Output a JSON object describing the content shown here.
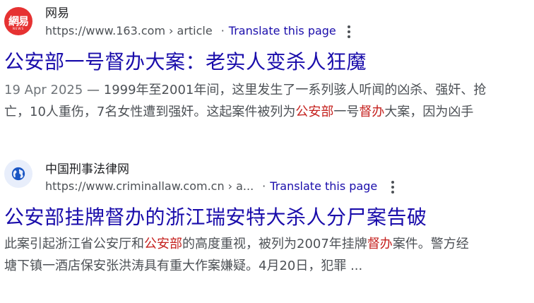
{
  "results": [
    {
      "site_name": "网易",
      "favicon_text": "網易",
      "favicon_sub": "NEWS",
      "url": "https://www.163.com",
      "breadcrumb": "› article",
      "translate_label": "Translate this page",
      "title": "公安部一号督办大案：老实人变杀人狂魔",
      "snippet": {
        "date": "19 Apr 2025",
        "dash": " — ",
        "line1_text": "1999年至2001年间，这里发生了一系列骇人听闻的凶杀、强奸、抢",
        "line2_a": "亡，10人重伤，7名女性遭到强奸。这起案件被列为",
        "line2_hl1": "公安部",
        "line2_b": "一号",
        "line2_hl2": "督办",
        "line2_c": "大案，因为凶手"
      }
    },
    {
      "site_name": "中国刑事法律网",
      "url": "https://www.criminallaw.com.cn",
      "breadcrumb": "› a...",
      "translate_label": "Translate this page",
      "title": "公安部挂牌督办的浙江瑞安特大杀人分尸案告破",
      "snippet": {
        "line1_a": "此案引起浙江省公安厅和",
        "line1_hl1": "公安部",
        "line1_b": "的高度重视，被列为2007年挂牌",
        "line1_hl2": "督办",
        "line1_c": "案件。警方经",
        "line2": "塘下镇一酒店保安张洪涛具有重大作案嫌疑。4月20日，犯罪 ..."
      }
    }
  ],
  "colors": {
    "link": "#1a0dab",
    "highlight": "#c5221f",
    "text": "#4d5156",
    "favicon_netease": "#e63232"
  },
  "icons": {
    "result1_favicon": "netease-logo-icon",
    "result2_favicon": "globe-icon",
    "menu": "more-vert-icon"
  }
}
